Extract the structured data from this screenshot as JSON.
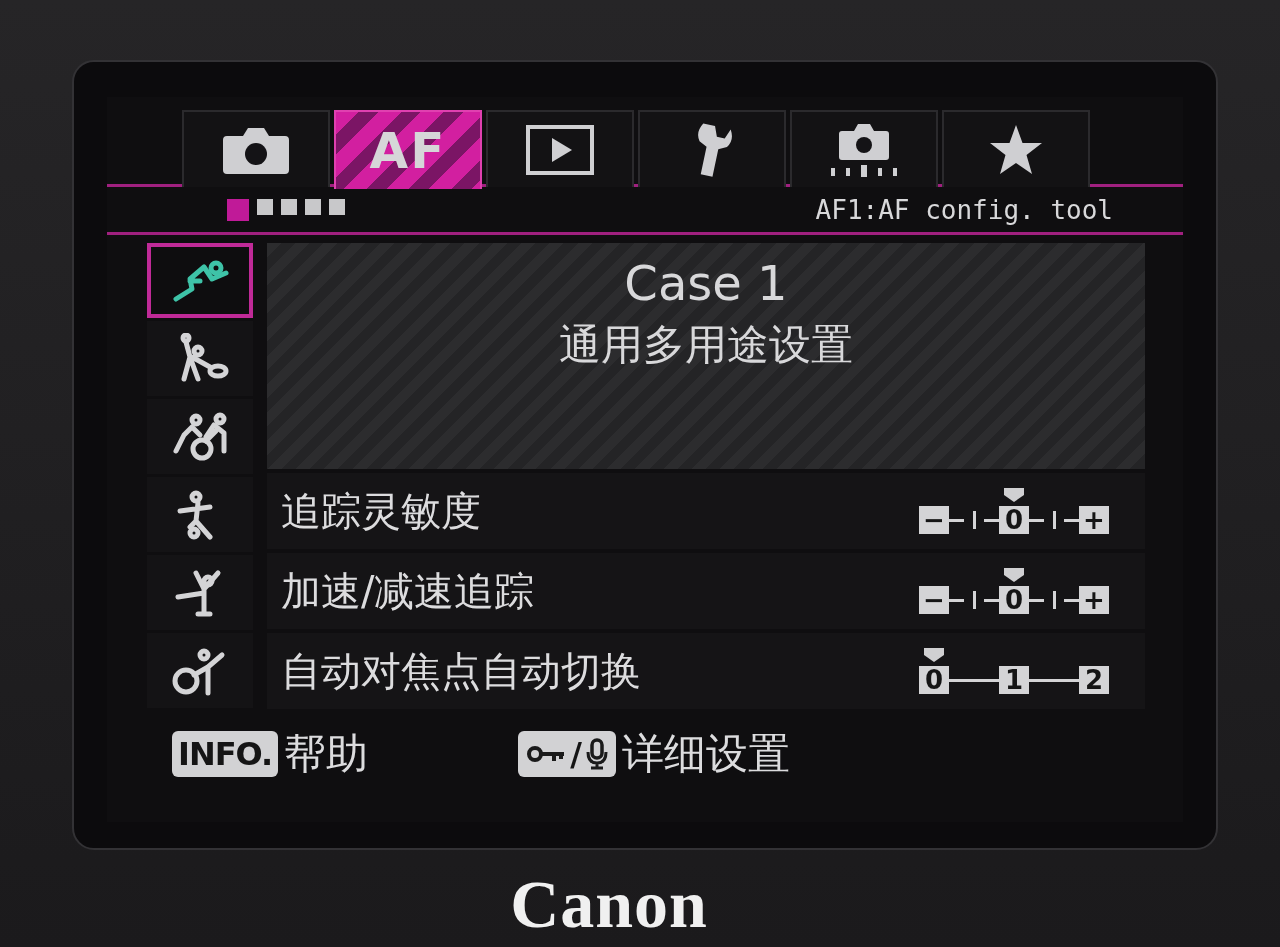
{
  "tabs": [
    {
      "kind": "camera",
      "selected": false
    },
    {
      "kind": "af",
      "label": "AF",
      "selected": true
    },
    {
      "kind": "play",
      "selected": false
    },
    {
      "kind": "wrench",
      "selected": false
    },
    {
      "kind": "camera-dots",
      "selected": false
    },
    {
      "kind": "star",
      "selected": false
    }
  ],
  "pages": [
    {
      "selected": true
    },
    {
      "selected": false
    },
    {
      "selected": false
    },
    {
      "selected": false
    },
    {
      "selected": false
    }
  ],
  "menu_title": "AF1:AF config. tool",
  "cases": [
    {
      "kind": "runner",
      "selected": true
    },
    {
      "kind": "tennis",
      "selected": false
    },
    {
      "kind": "cyclists",
      "selected": false
    },
    {
      "kind": "soccer",
      "selected": false
    },
    {
      "kind": "skater",
      "selected": false
    },
    {
      "kind": "gymnast",
      "selected": false
    }
  ],
  "case_panel": {
    "title": "Case 1",
    "subtitle": "通用多用途设置"
  },
  "settings": [
    {
      "label": "追踪灵敏度",
      "steps": [
        {
          "kind": "box",
          "label": "−",
          "selected": false
        },
        {
          "kind": "tick",
          "selected": false
        },
        {
          "kind": "box",
          "label": "0",
          "selected": true
        },
        {
          "kind": "tick",
          "selected": false
        },
        {
          "kind": "box",
          "label": "+",
          "selected": false
        }
      ]
    },
    {
      "label": "加速/减速追踪",
      "steps": [
        {
          "kind": "box",
          "label": "−",
          "selected": false
        },
        {
          "kind": "tick",
          "selected": false
        },
        {
          "kind": "box",
          "label": "0",
          "selected": true
        },
        {
          "kind": "tick",
          "selected": false
        },
        {
          "kind": "box",
          "label": "+",
          "selected": false
        }
      ]
    },
    {
      "label": "自动对焦点自动切换",
      "steps": [
        {
          "kind": "box",
          "label": "0",
          "selected": true
        },
        {
          "kind": "box",
          "label": "1",
          "selected": false
        },
        {
          "kind": "box",
          "label": "2",
          "selected": false
        }
      ]
    }
  ],
  "footer": [
    {
      "kind": "text-key",
      "key": "INFO.",
      "label": "帮助"
    },
    {
      "kind": "icon-key",
      "key": "/",
      "label": "详细设置"
    }
  ],
  "brand": "Canon"
}
